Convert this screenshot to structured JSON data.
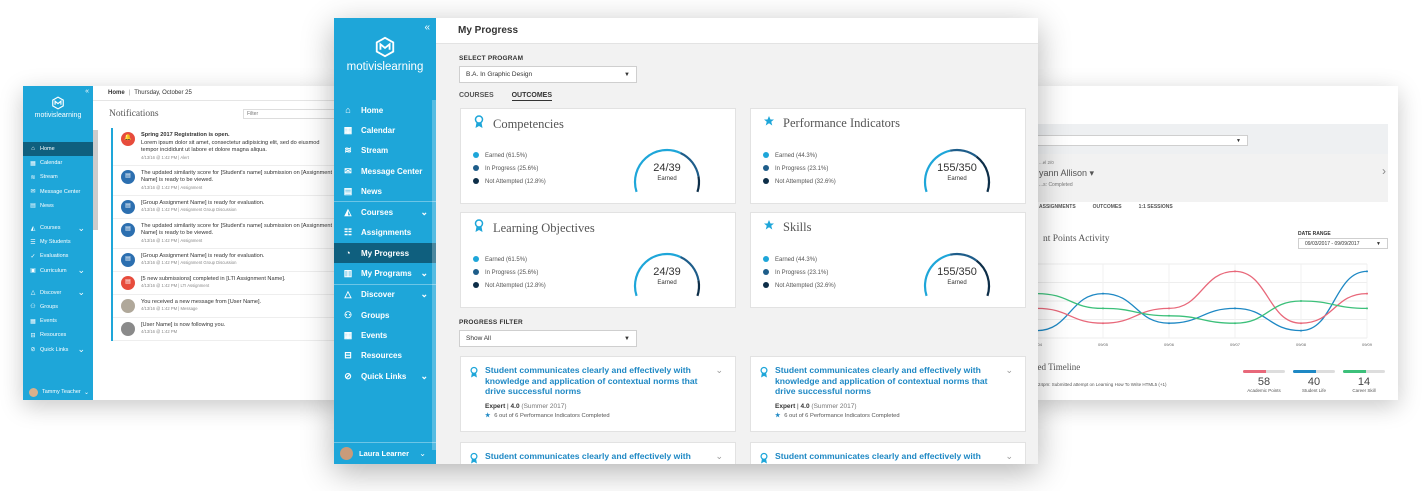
{
  "left_window": {
    "header": {
      "title": "Home",
      "date": "Thursday, October 25"
    },
    "notifications_title": "Notifications",
    "filter_placeholder": "Filter",
    "nav": [
      {
        "label": "Home",
        "icon": "home-icon",
        "active": true
      },
      {
        "label": "Calendar",
        "icon": "calendar-icon"
      },
      {
        "label": "Stream",
        "icon": "stream-icon"
      },
      {
        "label": "Message Center",
        "icon": "message-icon"
      },
      {
        "label": "News",
        "icon": "news-icon"
      },
      {
        "label": "Courses",
        "icon": "courses-icon",
        "chevron": true
      },
      {
        "label": "My Students",
        "icon": "students-icon"
      },
      {
        "label": "Evaluations",
        "icon": "evaluations-icon"
      },
      {
        "label": "Curriculum",
        "icon": "curriculum-icon",
        "chevron": true
      },
      {
        "label": "Discover",
        "icon": "discover-icon",
        "chevron": true
      },
      {
        "label": "Groups",
        "icon": "groups-icon"
      },
      {
        "label": "Events",
        "icon": "events-icon"
      },
      {
        "label": "Resources",
        "icon": "resources-icon"
      },
      {
        "label": "Quick Links",
        "icon": "links-icon",
        "chevron": true
      }
    ],
    "user": "Tammy Teacher",
    "items": [
      {
        "title": "Spring 2017 Registration is open.",
        "body": "Lorem ipsum dolor sit amet, consectetur adipisicing elit, sed do eiusmod tempor incididunt ut labore et dolore magna aliqua.",
        "meta": "4/13/16 @ 1:42 PM | Alert",
        "color": "#e74c3c"
      },
      {
        "title": "",
        "body": "The updated similarity score for [Student's name] submission on [Assignment Name] is ready to be viewed.",
        "meta": "4/13/16 @ 1:42 PM | Assignment",
        "color": "#2c6fb0"
      },
      {
        "title": "",
        "body": "[Group Assignment Name] is ready for evaluation.",
        "meta": "4/13/16 @ 1:42 PM | Assignment Group Discussion",
        "color": "#2c6fb0"
      },
      {
        "title": "",
        "body": "The updated similarity score for [Student's name] submission on [Assignment Name] is ready to be viewed.",
        "meta": "4/13/16 @ 1:42 PM | Assignment",
        "color": "#2c6fb0"
      },
      {
        "title": "",
        "body": "[Group Assignment Name] is ready for evaluation.",
        "meta": "4/13/16 @ 1:42 PM | Assignment Group Discussion",
        "color": "#2c6fb0"
      },
      {
        "title": "",
        "body": "[5 new submissions] completed in [LTI Assignment Name].",
        "meta": "4/13/16 @ 1:42 PM | LTI Assignment",
        "color": "#e74c3c"
      },
      {
        "title": "",
        "body": "You received a new message from [User Name].",
        "meta": "4/13/16 @ 1:42 PM | Message",
        "color": "#b0a89a"
      },
      {
        "title": "",
        "body": "[User Name] is now following you.",
        "meta": "4/13/16 @ 1:42 PM",
        "color": "#8a8a8a"
      }
    ]
  },
  "center_window": {
    "brand": "motivislearning",
    "page_title": "My Progress",
    "select_program_label": "SELECT PROGRAM",
    "program_value": "B.A. In Graphic Design",
    "tabs": [
      "COURSES",
      "OUTCOMES"
    ],
    "nav": [
      {
        "label": "Home",
        "icon": "home-icon"
      },
      {
        "label": "Calendar",
        "icon": "calendar-icon"
      },
      {
        "label": "Stream",
        "icon": "stream-icon"
      },
      {
        "label": "Message Center",
        "icon": "message-icon"
      },
      {
        "label": "News",
        "icon": "news-icon"
      },
      {
        "label": "Courses",
        "icon": "courses-icon",
        "chevron": true,
        "sep": true
      },
      {
        "label": "Assignments",
        "icon": "assignments-icon"
      },
      {
        "label": "My Progress",
        "icon": "progress-icon",
        "active": true
      },
      {
        "label": "My Programs",
        "icon": "programs-icon",
        "chevron": true
      },
      {
        "label": "Discover",
        "icon": "discover-icon",
        "chevron": true,
        "sep": true
      },
      {
        "label": "Groups",
        "icon": "groups-icon"
      },
      {
        "label": "Events",
        "icon": "events-icon"
      },
      {
        "label": "Resources",
        "icon": "resources-icon"
      },
      {
        "label": "Quick Links",
        "icon": "links-icon",
        "chevron": true
      }
    ],
    "user": "Laura Learner",
    "cards": [
      {
        "title": "Competencies",
        "icon": "ribbon-icon",
        "legend": [
          "Earned (61.5%)",
          "In Progress (25.6%)",
          "Not Attempted (12.8%)"
        ],
        "value": "24/39",
        "label": "Earned",
        "earned_fraction": 0.615,
        "progress_fraction": 0.256
      },
      {
        "title": "Performance Indicators",
        "icon": "star-icon",
        "legend": [
          "Earned (44.3%)",
          "In Progress (23.1%)",
          "Not Attempted (32.6%)"
        ],
        "value": "155/350",
        "label": "Earned",
        "earned_fraction": 0.443,
        "progress_fraction": 0.231
      },
      {
        "title": "Learning Objectives",
        "icon": "ribbon-icon",
        "legend": [
          "Earned (61.5%)",
          "In Progress (25.6%)",
          "Not Attempted (12.8%)"
        ],
        "value": "24/39",
        "label": "Earned",
        "earned_fraction": 0.615,
        "progress_fraction": 0.256
      },
      {
        "title": "Skills",
        "icon": "star-icon",
        "legend": [
          "Earned (44.3%)",
          "In Progress (23.1%)",
          "Not Attempted (32.6%)"
        ],
        "value": "155/350",
        "label": "Earned",
        "earned_fraction": 0.443,
        "progress_fraction": 0.231
      }
    ],
    "progress_filter_label": "PROGRESS FILTER",
    "filter_value": "Show All",
    "outcomes": [
      {
        "title": "Student communicates clearly and effectively with knowledge and application of contextual norms that drive successful norms",
        "level": "Expert",
        "score": "4.0",
        "term": "(Summer 2017)",
        "indicators": "6 out of 6 Performance Indicators Completed"
      },
      {
        "title": "Student communicates clearly and effectively with knowledge and application of contextual norms that drive successful norms",
        "level": "Expert",
        "score": "4.0",
        "term": "(Summer 2017)",
        "indicators": "6 out of 6 Performance Indicators Completed"
      },
      {
        "title": "Student communicates clearly and effectively with",
        "level": "",
        "score": "",
        "term": "",
        "indicators": ""
      },
      {
        "title": "Student communicates clearly and effectively with",
        "level": "",
        "score": "",
        "term": "",
        "indicators": ""
      }
    ],
    "colors": {
      "earned": "#1ea6d9",
      "in_progress": "#1e5d8a",
      "not_attempted": "#0d2e48",
      "accent": "#1ea6d9"
    }
  },
  "right_window": {
    "student_level": "...el 2/0",
    "student_name": "yann Allison",
    "status": "...s: Completed",
    "tabs": [
      "ASSIGNMENTS",
      "OUTCOMES",
      "1:1 SESSIONS"
    ],
    "activity_title": "nt Points Activity",
    "date_range_label": "DATE RANGE",
    "date_range_value": "09/03/2017 - 09/09/2017",
    "timeline_title": "ned Timeline",
    "timeline_entry": "6:24pm: Submitted attempt on Learning How To Write HTML5 (+1)",
    "stats": [
      {
        "value": "58",
        "label": "Academic Points",
        "color": "#e8687a"
      },
      {
        "value": "40",
        "label": "Student Life",
        "color": "#1e88c4"
      },
      {
        "value": "14",
        "label": "Career Skill",
        "color": "#3cc07a"
      }
    ],
    "x_ticks": [
      "09/04",
      "09/05",
      "09/06",
      "09/07",
      "09/08",
      "09/09"
    ]
  },
  "chart_data": {
    "type": "line",
    "x": [
      "09/04",
      "09/05",
      "09/06",
      "09/07",
      "09/08",
      "09/09"
    ],
    "series": [
      {
        "values": [
          1,
          6,
          2,
          4,
          1,
          9
        ],
        "color": "#1e88c4"
      },
      {
        "values": [
          4,
          2,
          4,
          9,
          2,
          6
        ],
        "color": "#e8687a"
      },
      {
        "values": [
          6,
          4,
          3,
          2,
          5,
          4
        ],
        "color": "#3cc07a"
      }
    ],
    "ylim": [
      0,
      10
    ],
    "grid": true
  }
}
